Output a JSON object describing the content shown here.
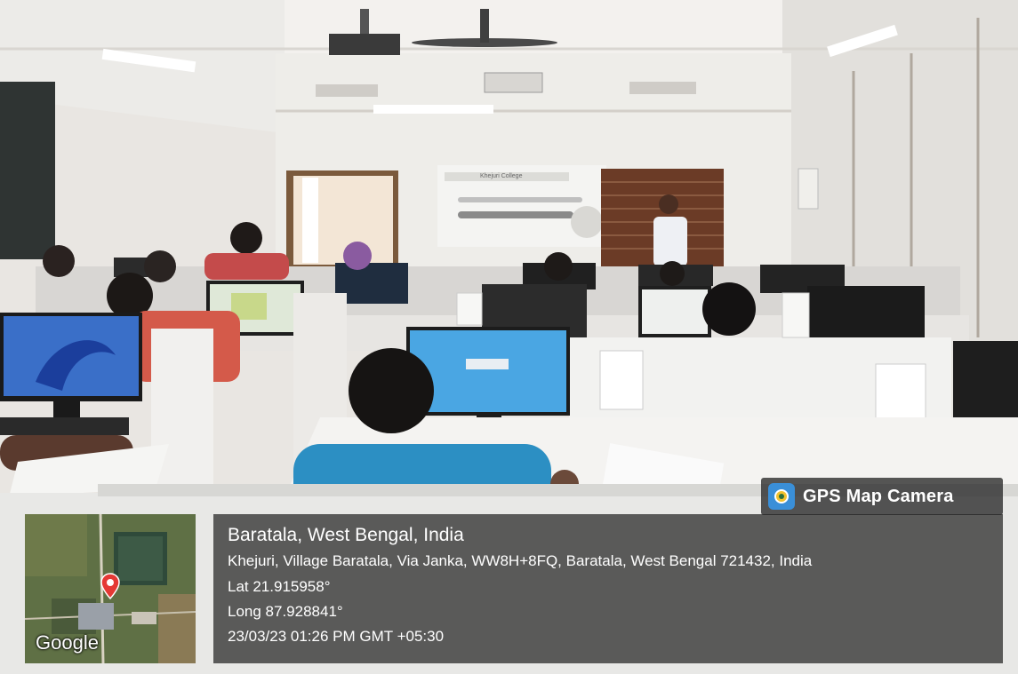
{
  "photo": {
    "slide_title": "Khejuri College"
  },
  "gps_badge": {
    "label": "GPS Map Camera",
    "icon": "gps-map-camera-icon"
  },
  "map_thumbnail": {
    "provider_label": "Google",
    "pin_icon": "map-pin-icon"
  },
  "location": {
    "title": "Baratala, West Bengal, India",
    "address": "Khejuri, Village Baratala, Via Janka, WW8H+8FQ, Baratala, West Bengal 721432, India",
    "lat": "Lat 21.915958°",
    "long": "Long 87.928841°",
    "datetime": "23/03/23 01:26 PM GMT +05:30"
  },
  "colors": {
    "overlay_bg": "#232323",
    "overlay_text": "#ffffff",
    "pin": "#e53935"
  }
}
